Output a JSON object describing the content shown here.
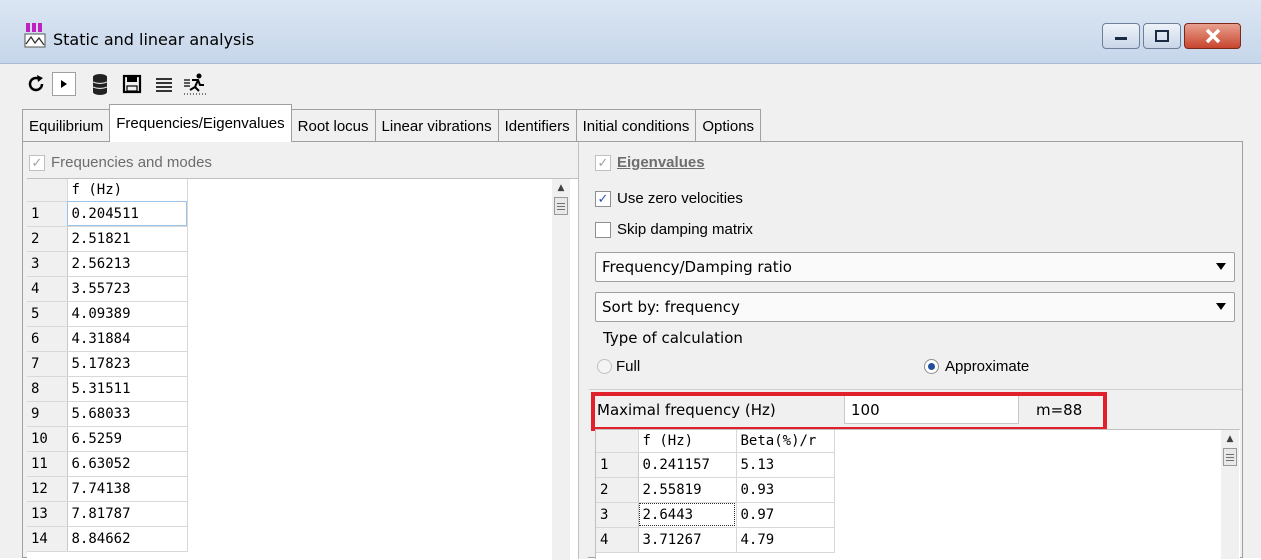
{
  "window": {
    "title": "Static and linear analysis"
  },
  "toolbar": {
    "icons": [
      "refresh-icon",
      "play-icon",
      "database-icon",
      "save-icon",
      "list-icon",
      "run-icon"
    ]
  },
  "tabs": [
    {
      "label": "Equilibrium",
      "active": false
    },
    {
      "label": "Frequencies/Eigenvalues",
      "active": true
    },
    {
      "label": "Root locus",
      "active": false
    },
    {
      "label": "Linear vibrations",
      "active": false
    },
    {
      "label": "Identifiers",
      "active": false
    },
    {
      "label": "Initial conditions",
      "active": false
    },
    {
      "label": "Options",
      "active": false
    }
  ],
  "left": {
    "checkbox_label": "Frequencies and modes",
    "column_header": "f (Hz)",
    "rows": [
      {
        "n": "1",
        "f": "0.204511"
      },
      {
        "n": "2",
        "f": "2.51821"
      },
      {
        "n": "3",
        "f": "2.56213"
      },
      {
        "n": "4",
        "f": "3.55723"
      },
      {
        "n": "5",
        "f": "4.09389"
      },
      {
        "n": "6",
        "f": "4.31884"
      },
      {
        "n": "7",
        "f": "5.17823"
      },
      {
        "n": "8",
        "f": "5.31511"
      },
      {
        "n": "9",
        "f": "5.68033"
      },
      {
        "n": "10",
        "f": "6.5259"
      },
      {
        "n": "11",
        "f": "6.63052"
      },
      {
        "n": "12",
        "f": "7.74138"
      },
      {
        "n": "13",
        "f": "7.81787"
      },
      {
        "n": "14",
        "f": "8.84662"
      }
    ]
  },
  "right": {
    "eigenvalues_label": "Eigenvalues",
    "use_zero_velocities": "Use zero velocities",
    "skip_damping": "Skip damping matrix",
    "display_combo": "Frequency/Damping ratio",
    "sort_combo": "Sort by: frequency",
    "calc_type_label": "Type of calculation",
    "radio_full": "Full",
    "radio_approx": "Approximate",
    "max_freq_label": "Maximal frequency (Hz)",
    "max_freq_value": "100",
    "m_count": "m=88",
    "col_f": "f (Hz)",
    "col_beta": "Beta(%)/r",
    "rows": [
      {
        "n": "1",
        "f": "0.241157",
        "beta": "5.13"
      },
      {
        "n": "2",
        "f": "2.55819",
        "beta": "0.93"
      },
      {
        "n": "3",
        "f": "2.6443",
        "beta": "0.97"
      },
      {
        "n": "4",
        "f": "3.71267",
        "beta": "4.79"
      }
    ]
  },
  "colors": {
    "highlight_border": "#e0202a",
    "checkbox_check": "#2a52be"
  }
}
